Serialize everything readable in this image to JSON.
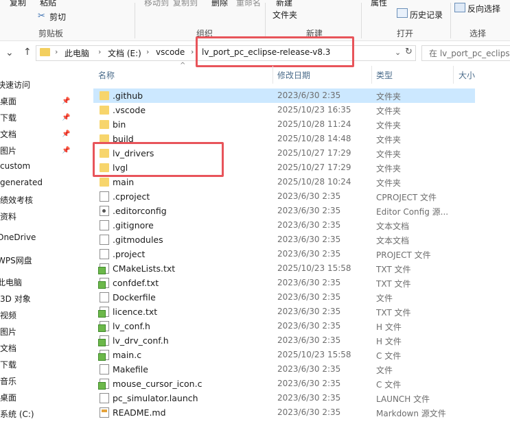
{
  "ribbon": {
    "paste": "粘贴",
    "cut": "剪切",
    "clipboard_group": "剪贴板",
    "move_to": "移动到",
    "copy_to": "复制到",
    "delete": "删除",
    "rename": "重命名",
    "organize_group": "组织",
    "new_folder_line1": "新建",
    "new_folder_line2": "文件夹",
    "new_group": "新建",
    "properties": "属性",
    "history": "历史记录",
    "open_group": "打开",
    "invert_selection": "反向选择",
    "select_group": "选择",
    "copy": "复制"
  },
  "address": {
    "crumbs": [
      "此电脑",
      "文档 (E:)",
      "vscode",
      "lv_port_pc_eclipse-release-v8.3"
    ],
    "search_placeholder": "在 lv_port_pc_eclipse-re"
  },
  "sidebar": {
    "items": [
      "快速访问",
      "桌面",
      "下载",
      "文档",
      "图片",
      "custom",
      "generated",
      "绩效考核",
      "资料",
      "OneDrive",
      "WPS网盘",
      "此电脑",
      "3D 对象",
      "视频",
      "图片",
      "文档",
      "下载",
      "音乐",
      "桌面",
      "系统 (C:)"
    ]
  },
  "columns": {
    "name": "名称",
    "modified": "修改日期",
    "type": "类型",
    "size": "大小"
  },
  "files": [
    {
      "name": ".github",
      "date": "2023/6/30 2:35",
      "type": "文件夹",
      "icon": "folder-icon"
    },
    {
      "name": ".vscode",
      "date": "2025/10/23 16:35",
      "type": "文件夹",
      "icon": "folder-icon"
    },
    {
      "name": "bin",
      "date": "2025/10/28 11:24",
      "type": "文件夹",
      "icon": "folder-icon"
    },
    {
      "name": "build",
      "date": "2025/10/28 14:48",
      "type": "文件夹",
      "icon": "folder-icon"
    },
    {
      "name": "lv_drivers",
      "date": "2025/10/27 17:29",
      "type": "文件夹",
      "icon": "folder-icon"
    },
    {
      "name": "lvgl",
      "date": "2025/10/27 17:29",
      "type": "文件夹",
      "icon": "folder-icon"
    },
    {
      "name": "main",
      "date": "2025/10/28 10:24",
      "type": "文件夹",
      "icon": "folder-icon"
    },
    {
      "name": ".cproject",
      "date": "2023/6/30 2:35",
      "type": "CPROJECT 文件",
      "icon": "file-icon"
    },
    {
      "name": ".editorconfig",
      "date": "2023/6/30 2:35",
      "type": "Editor Config 源...",
      "icon": "config-file-icon"
    },
    {
      "name": ".gitignore",
      "date": "2023/6/30 2:35",
      "type": "文本文档",
      "icon": "file-icon"
    },
    {
      "name": ".gitmodules",
      "date": "2023/6/30 2:35",
      "type": "文本文档",
      "icon": "file-icon"
    },
    {
      "name": ".project",
      "date": "2023/6/30 2:35",
      "type": "PROJECT 文件",
      "icon": "file-icon"
    },
    {
      "name": "CMakeLists.txt",
      "date": "2025/10/23 15:58",
      "type": "TXT 文件",
      "icon": "txt-file-icon"
    },
    {
      "name": "confdef.txt",
      "date": "2023/6/30 2:35",
      "type": "TXT 文件",
      "icon": "txt-file-icon"
    },
    {
      "name": "Dockerfile",
      "date": "2023/6/30 2:35",
      "type": "文件",
      "icon": "file-icon"
    },
    {
      "name": "licence.txt",
      "date": "2023/6/30 2:35",
      "type": "TXT 文件",
      "icon": "txt-file-icon"
    },
    {
      "name": "lv_conf.h",
      "date": "2023/6/30 2:35",
      "type": "H 文件",
      "icon": "txt-file-icon"
    },
    {
      "name": "lv_drv_conf.h",
      "date": "2023/6/30 2:35",
      "type": "H 文件",
      "icon": "txt-file-icon"
    },
    {
      "name": "main.c",
      "date": "2025/10/23 15:58",
      "type": "C 文件",
      "icon": "txt-file-icon"
    },
    {
      "name": "Makefile",
      "date": "2023/6/30 2:35",
      "type": "文件",
      "icon": "file-icon"
    },
    {
      "name": "mouse_cursor_icon.c",
      "date": "2023/6/30 2:35",
      "type": "C 文件",
      "icon": "txt-file-icon"
    },
    {
      "name": "pc_simulator.launch",
      "date": "2023/6/30 2:35",
      "type": "LAUNCH 文件",
      "icon": "launch-file-icon"
    },
    {
      "name": "README.md",
      "date": "2023/6/30 2:35",
      "type": "Markdown 源文件",
      "icon": "markdown-file-icon"
    }
  ]
}
